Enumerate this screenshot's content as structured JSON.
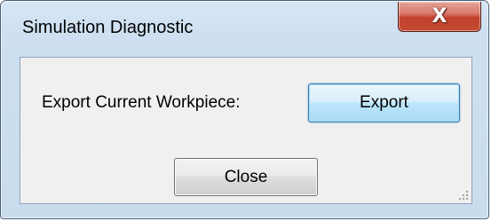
{
  "window": {
    "title": "Simulation Diagnostic",
    "close_glyph": "X"
  },
  "content": {
    "export_label": "Export Current Workpiece:",
    "export_button": "Export",
    "close_button": "Close"
  },
  "colors": {
    "frame": "#cddff0",
    "client": "#f0f0f0",
    "close_red": "#c2402b",
    "focus_blue": "#3c7fb1"
  },
  "icons": {
    "close": "close-icon",
    "resize_grip": "resize-grip-icon"
  }
}
